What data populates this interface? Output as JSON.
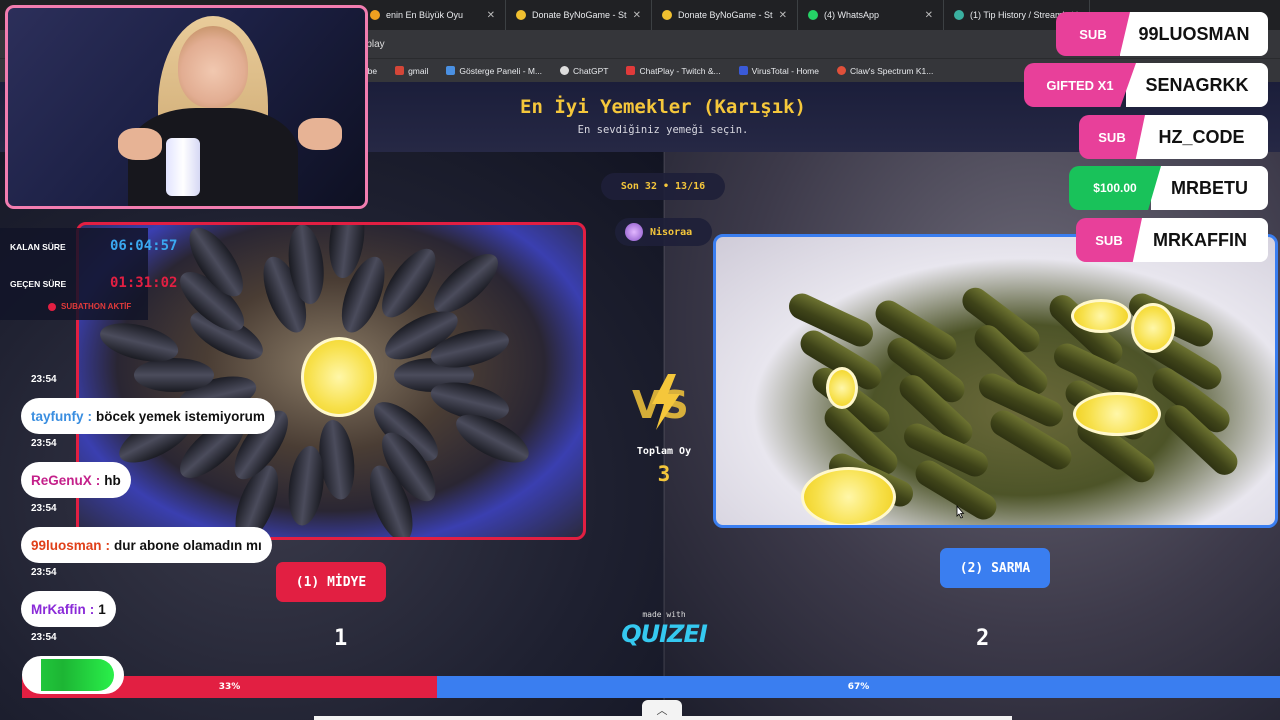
{
  "browser": {
    "tabs": [
      {
        "title": "enin En Büyük Oyu",
        "color": "#f0a020"
      },
      {
        "title": "Donate ByNoGame - Stre",
        "color": "#f0c030"
      },
      {
        "title": "Donate ByNoGame - Stre",
        "color": "#f0c030"
      },
      {
        "title": "(4) WhatsApp",
        "color": "#25d366"
      },
      {
        "title": "(1) Tip History / Streamla",
        "color": "#3ab0a0"
      }
    ],
    "address": "o/play",
    "bookmarks": [
      {
        "label": "Tube",
        "color": "#e02020"
      },
      {
        "label": "gmail",
        "color": "#d44638"
      },
      {
        "label": "Gösterge Paneli - M...",
        "color": "#4a90e2"
      },
      {
        "label": "ChatGPT",
        "color": "#dddddd"
      },
      {
        "label": "ChatPlay - Twitch &...",
        "color": "#e03a3a"
      },
      {
        "label": "VirusTotal - Home",
        "color": "#3a5ad8"
      },
      {
        "label": "Claw's Spectrum K1...",
        "color": "#e0503a"
      }
    ]
  },
  "quiz": {
    "title": "En İyi Yemekler (Karışık)",
    "subtitle": "En sevdiğiniz yemeği seçin.",
    "round": "Son 32 • 13/16",
    "user": "Nisoraa",
    "total_label": "Toplam Oy",
    "total_votes": "3",
    "made_with": "made with",
    "brand": "QUIZEI",
    "left": {
      "label": "(1) MİDYE",
      "votes": "1",
      "percent": 33,
      "percent_text": "33%",
      "color": "#e21f42"
    },
    "right": {
      "label": "(2) SARMA",
      "votes": "2",
      "percent": 67,
      "percent_text": "67%",
      "color": "#3a7ef0"
    }
  },
  "timers": {
    "remaining_label": "KALAN SÜRE",
    "remaining_value": "06:04:57",
    "elapsed_label": "GEÇEN SÜRE",
    "elapsed_value": "01:31:02",
    "subathon": "SUBATHON AKTİF"
  },
  "chat": [
    {
      "time": "23:54"
    },
    {
      "user": "tayfunfy",
      "sep": " : ",
      "text": "böcek yemek istemiyorum",
      "color": "#3a8ee0",
      "time": "23:54"
    },
    {
      "user": "ReGenuX",
      "sep": " : ",
      "text": "hb",
      "color": "#c4208a",
      "time": "23:54"
    },
    {
      "user": "99luosman",
      "sep": " : ",
      "text": "dur abone olamadın mı",
      "color": "#e0401a",
      "time": "23:54"
    },
    {
      "user": "MrKaffin",
      "sep": " : ",
      "text": "1",
      "color": "#8a2ad8",
      "time": "23:54"
    }
  ],
  "goal": {
    "fill": 0.85
  },
  "alerts": [
    {
      "tag": "SUB",
      "name": "99LUOSMAN",
      "tag_color": "#e8409a"
    },
    {
      "tag": "GIFTED X1",
      "name": "SENAGRKK",
      "tag_color": "#e8409a"
    },
    {
      "tag": "SUB",
      "name": "HZ_CODE",
      "tag_color": "#e8409a"
    },
    {
      "tag": "$100.00",
      "name": "MRBETU",
      "tag_color": "#19c25a"
    },
    {
      "tag": "SUB",
      "name": "MRKAFFIN",
      "tag_color": "#e8409a"
    }
  ]
}
